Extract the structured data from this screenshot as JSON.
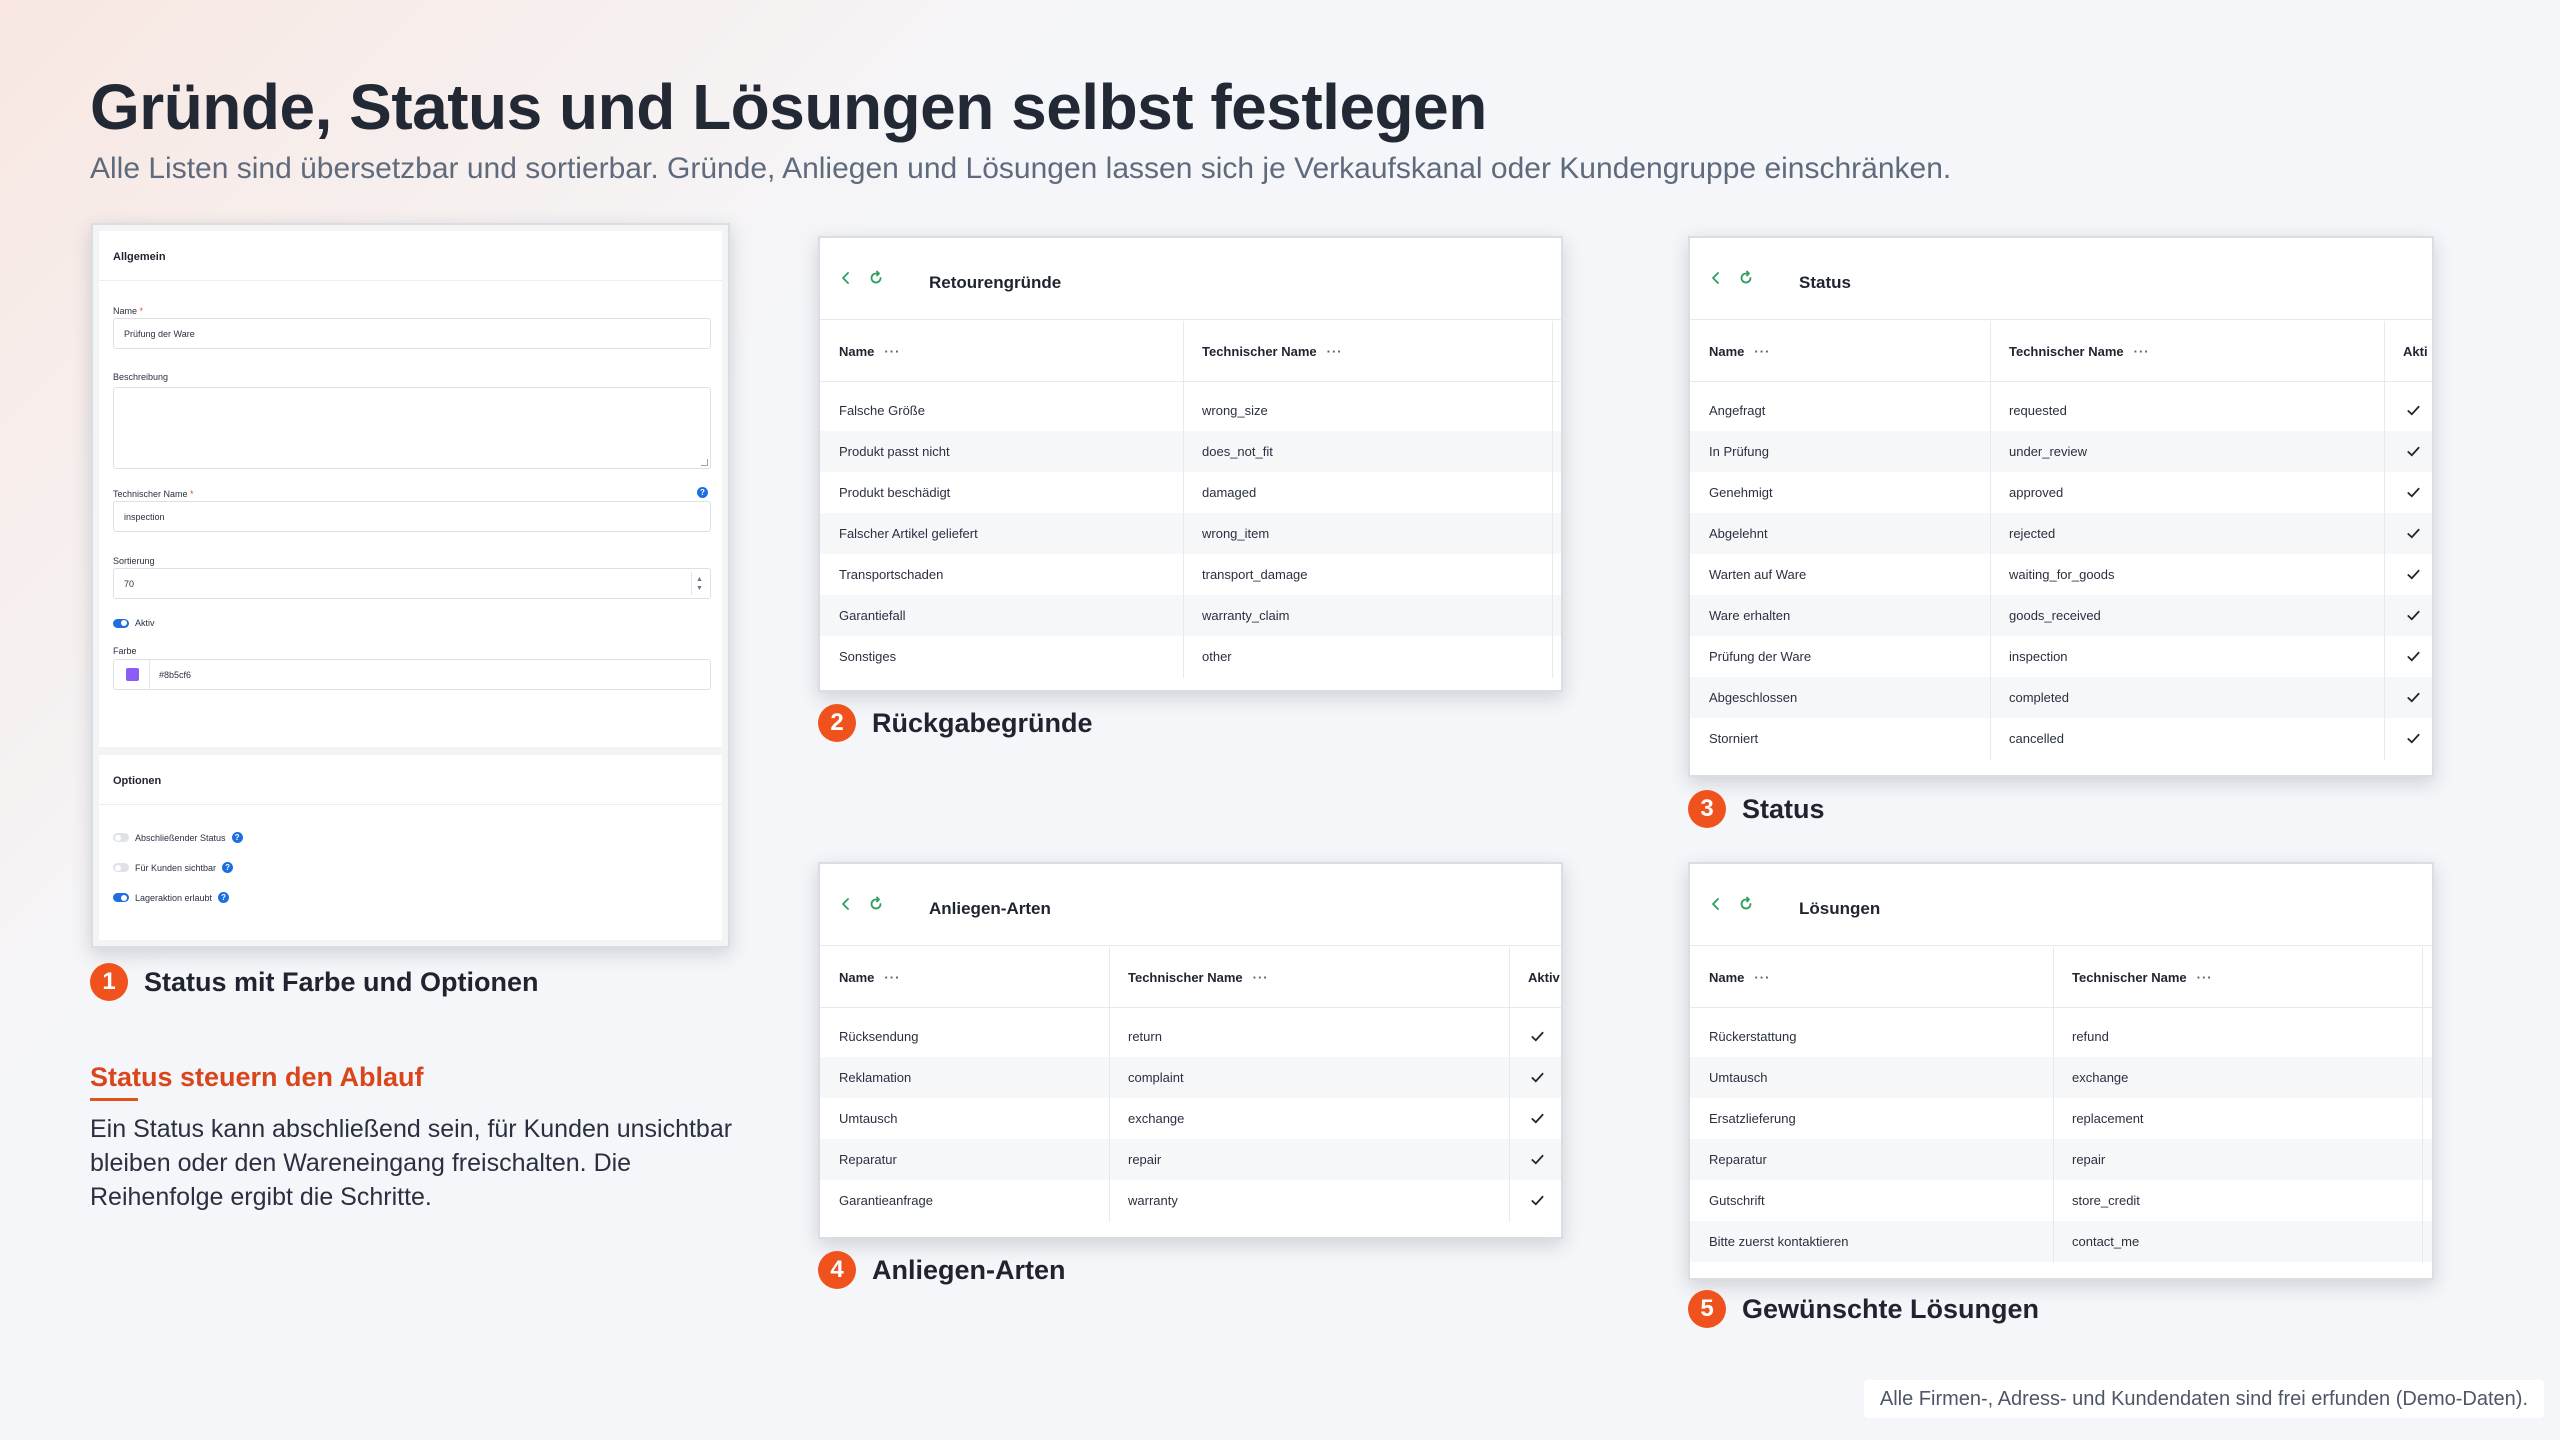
{
  "header": {
    "title": "Gründe, Status und Lösungen selbst festlegen",
    "subtitle": "Alle Listen sind übersetzbar und sortierbar. Gründe, Anliegen und Lösungen lassen sich je Verkaufskanal oder Kundengruppe einschränken."
  },
  "form": {
    "general_title": "Allgemein",
    "name_label": "Name",
    "name_value": "Prüfung der Ware",
    "description_label": "Beschreibung",
    "description_value": "",
    "technical_name_label": "Technischer Name",
    "technical_name_value": "inspection",
    "sort_label": "Sortierung",
    "sort_value": "70",
    "active_label": "Aktiv",
    "color_label": "Farbe",
    "color_value": "#8b5cf6",
    "options_title": "Optionen",
    "options": [
      {
        "label": "Abschließender Status",
        "on": false
      },
      {
        "label": "Für Kunden sichtbar",
        "on": false
      },
      {
        "label": "Lageraktion erlaubt",
        "on": true
      }
    ]
  },
  "columns": {
    "name": "Name",
    "technical_name": "Technischer Name",
    "active": "Aktiv",
    "more": "···"
  },
  "return_reasons": {
    "title": "Retourengründe",
    "rows": [
      {
        "name": "Falsche Größe",
        "tech": "wrong_size"
      },
      {
        "name": "Produkt passt nicht",
        "tech": "does_not_fit"
      },
      {
        "name": "Produkt beschädigt",
        "tech": "damaged"
      },
      {
        "name": "Falscher Artikel geliefert",
        "tech": "wrong_item"
      },
      {
        "name": "Transportschaden",
        "tech": "transport_damage"
      },
      {
        "name": "Garantiefall",
        "tech": "warranty_claim"
      },
      {
        "name": "Sonstiges",
        "tech": "other"
      }
    ]
  },
  "status": {
    "title": "Status",
    "active_header": "Akti",
    "rows": [
      {
        "name": "Angefragt",
        "tech": "requested",
        "active": true
      },
      {
        "name": "In Prüfung",
        "tech": "under_review",
        "active": true
      },
      {
        "name": "Genehmigt",
        "tech": "approved",
        "active": true
      },
      {
        "name": "Abgelehnt",
        "tech": "rejected",
        "active": true
      },
      {
        "name": "Warten auf Ware",
        "tech": "waiting_for_goods",
        "active": true
      },
      {
        "name": "Ware erhalten",
        "tech": "goods_received",
        "active": true
      },
      {
        "name": "Prüfung der Ware",
        "tech": "inspection",
        "active": true
      },
      {
        "name": "Abgeschlossen",
        "tech": "completed",
        "active": true
      },
      {
        "name": "Storniert",
        "tech": "cancelled",
        "active": true
      }
    ]
  },
  "request_types": {
    "title": "Anliegen-Arten",
    "active_header": "Aktiv",
    "rows": [
      {
        "name": "Rücksendung",
        "tech": "return",
        "active": true
      },
      {
        "name": "Reklamation",
        "tech": "complaint",
        "active": true
      },
      {
        "name": "Umtausch",
        "tech": "exchange",
        "active": true
      },
      {
        "name": "Reparatur",
        "tech": "repair",
        "active": true
      },
      {
        "name": "Garantieanfrage",
        "tech": "warranty",
        "active": true
      }
    ]
  },
  "solutions": {
    "title": "Lösungen",
    "rows": [
      {
        "name": "Rückerstattung",
        "tech": "refund"
      },
      {
        "name": "Umtausch",
        "tech": "exchange"
      },
      {
        "name": "Ersatzlieferung",
        "tech": "replacement"
      },
      {
        "name": "Reparatur",
        "tech": "repair"
      },
      {
        "name": "Gutschrift",
        "tech": "store_credit"
      },
      {
        "name": "Bitte zuerst kontaktieren",
        "tech": "contact_me"
      }
    ]
  },
  "captions": [
    {
      "num": "1",
      "text": "Status mit Farbe und Optionen"
    },
    {
      "num": "2",
      "text": "Rückgabegründe"
    },
    {
      "num": "3",
      "text": "Status"
    },
    {
      "num": "4",
      "text": "Anliegen-Arten"
    },
    {
      "num": "5",
      "text": "Gewünschte Lösungen"
    }
  ],
  "side": {
    "heading": "Status steuern den Ablauf",
    "text": "Ein Status kann abschließend sein, für Kunden unsichtbar bleiben oder den Wareneingang freischalten. Die Reihenfolge ergibt die Schritte."
  },
  "footer_note": "Alle Firmen-, Adress- und Kundendaten sind frei erfunden (Demo-Daten).",
  "colors": {
    "accent": "#f0521e",
    "link_icon": "#2e9e5b",
    "toggle_on": "#1d6fe0",
    "status_color": "#8b5cf6"
  },
  "icons": [
    "back-icon",
    "refresh-icon",
    "check-icon",
    "help-icon"
  ]
}
